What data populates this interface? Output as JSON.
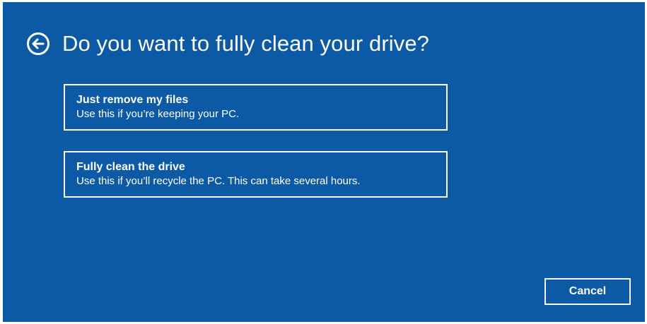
{
  "colors": {
    "background": "#0c5aa6",
    "foreground": "#ffffff"
  },
  "header": {
    "back_icon": "back-arrow-circle-icon",
    "title": "Do you want to fully clean your drive?"
  },
  "options": [
    {
      "title": "Just remove my files",
      "description": "Use this if you’re keeping your PC."
    },
    {
      "title": "Fully clean the drive",
      "description": "Use this if you’ll recycle the PC. This can take several hours."
    }
  ],
  "footer": {
    "cancel_label": "Cancel"
  }
}
